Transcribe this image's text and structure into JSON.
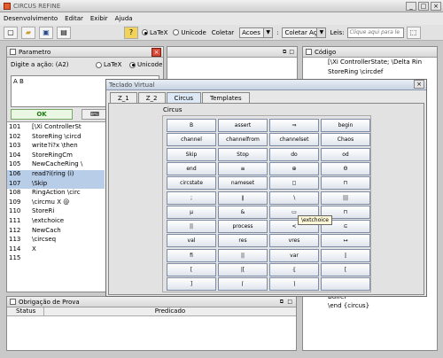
{
  "window": {
    "title": "CIRCUS REFINE"
  },
  "menu": [
    "Desenvolvimento",
    "Editar",
    "Exibir",
    "Ajuda"
  ],
  "toolbar": {
    "latex_label": "LaTeX",
    "unicode_label": "Unicode",
    "coletar_label": "Coletar",
    "acoes_combo": "Acoes",
    "coletar_combo": "Coletar Aç...",
    "leis_label": "Leis:",
    "leis_placeholder": "Clique aqui para le",
    "icons": [
      "new-file-icon",
      "open-folder-icon",
      "save-icon",
      "print-icon",
      "help-icon"
    ]
  },
  "parametro": {
    "title": "Parametro",
    "prompt": "Digite a ação: (A2)",
    "latex": "LaTeX",
    "unicode": "Unicode",
    "text": "A B",
    "ok": "OK"
  },
  "code_lines": [
    {
      "n": "101",
      "t": "[\\Xi ControllerSt",
      "sel": false
    },
    {
      "n": "102",
      "t": "StoreRing \\circd",
      "sel": false
    },
    {
      "n": "103",
      "t": "write?i?x \\then",
      "sel": false
    },
    {
      "n": "104",
      "t": "StoreRingCm",
      "sel": false
    },
    {
      "n": "105",
      "t": "NewCacheRing \\",
      "sel": false
    },
    {
      "n": "106",
      "t": "read?i(ring (i)",
      "sel": true
    },
    {
      "n": "107",
      "t": "\\Skip",
      "sel": true
    },
    {
      "n": "108",
      "t": "RingAction \\circ",
      "sel": false
    },
    {
      "n": "109",
      "t": "\\circmu X @",
      "sel": false
    },
    {
      "n": "110",
      "t": "StoreRi",
      "sel": false
    },
    {
      "n": "111",
      "t": "\\extchoice",
      "sel": false
    },
    {
      "n": "112",
      "t": "NewCach",
      "sel": false
    },
    {
      "n": "113",
      "t": "\\circseq",
      "sel": false
    },
    {
      "n": "114",
      "t": "X",
      "sel": false
    },
    {
      "n": "115",
      "t": "",
      "sel": false
    }
  ],
  "codigo": {
    "title": "Código",
    "lines": [
      "[\\Xi ControllerState; \\Delta Rin",
      "StoreRing \\circdef",
      "",
      "",
      "",
      "",
      "",
      "",
      "",
      "",
      "",
      "",
      "",
      "",
      "",
      "",
      "",
      "",
      "",
      "",
      "",
      "",
      "",
      "",
      "",
      "Buffer",
      "\\end {circus}"
    ]
  },
  "obrigacao": {
    "title": "Obrigação de Prova",
    "columns": [
      "Status",
      "Predicado"
    ]
  },
  "teclado": {
    "title": "Teclado Virtual",
    "tabs": [
      "Z_1",
      "Z_2",
      "Circus",
      "Templates"
    ],
    "active_tab": "Circus",
    "group_label": "Circus",
    "tooltip": "\\extchoice",
    "keys": [
      [
        "B",
        "assert",
        "⇒",
        "begin"
      ],
      [
        "channel",
        "channelfrom",
        "channelset",
        "Chaos"
      ],
      [
        "Skip",
        "Stop",
        "do",
        "od"
      ],
      [
        "end",
        "≡",
        "⊕",
        "Θ"
      ],
      [
        "circstate",
        "nameset",
        "◻",
        "⊓"
      ],
      [
        ";",
        "∥",
        "∖",
        "|||"
      ],
      [
        "μ",
        "&",
        "▭",
        "⊓"
      ],
      [
        "||",
        "process",
        "<",
        "⊆"
      ],
      [
        "val",
        "res",
        "vres",
        "↦"
      ],
      [
        "fi",
        "||",
        "var",
        "⟦"
      ],
      [
        "[",
        "|[",
        "⦃",
        "["
      ],
      [
        "]",
        "⌈",
        "⌉",
        ""
      ]
    ]
  }
}
